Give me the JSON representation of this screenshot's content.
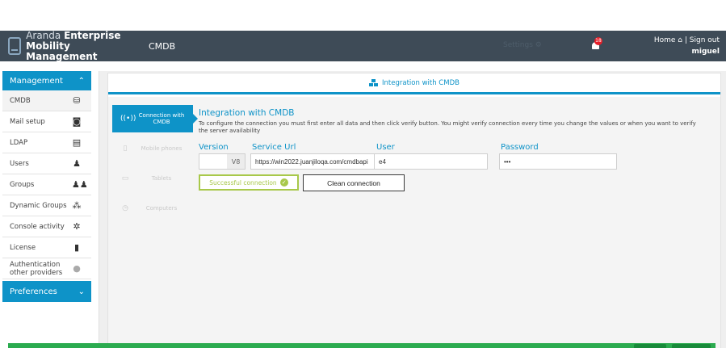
{
  "app": {
    "brand_line1_light": "Aranda ",
    "brand_line1_bold": "Enterprise",
    "brand_line2": "Mobility Management",
    "module": "CMDB",
    "settings_label": "Settings",
    "notifications_count": "18",
    "home_label": "Home",
    "signout_label": "Sign out",
    "username": "miguel"
  },
  "sidebar": {
    "section_title": "Management",
    "items": [
      {
        "label": "CMDB",
        "icon": "cmdb-icon",
        "glyph": "⛁"
      },
      {
        "label": "Mail setup",
        "icon": "mail-setup-icon",
        "glyph": "◙"
      },
      {
        "label": "LDAP",
        "icon": "ldap-icon",
        "glyph": "▤"
      },
      {
        "label": "Users",
        "icon": "user-icon",
        "glyph": "♟"
      },
      {
        "label": "Groups",
        "icon": "groups-icon",
        "glyph": "♟♟"
      },
      {
        "label": "Dynamic Groups",
        "icon": "dynamic-groups-icon",
        "glyph": "⁂"
      },
      {
        "label": "Console activity",
        "icon": "console-activity-icon",
        "glyph": "✲"
      },
      {
        "label": "License",
        "icon": "license-icon",
        "glyph": "▮"
      },
      {
        "label": "Authentication other providers",
        "icon": "auth-providers-icon",
        "glyph": "●"
      }
    ],
    "preferences_label": "Preferences"
  },
  "panel": {
    "title": "Integration with CMDB",
    "tabs": [
      {
        "label": "Connection with CMDB",
        "icon": "wireless-icon",
        "glyph": "((•))"
      },
      {
        "label": "Mobile phones",
        "icon": "mobile-phone-icon",
        "glyph": "▯"
      },
      {
        "label": "Tablets",
        "icon": "tablet-icon",
        "glyph": "▭"
      },
      {
        "label": "Computers",
        "icon": "computer-icon",
        "glyph": "◷"
      }
    ],
    "content": {
      "title": "Integration with CMDB",
      "description": "To configure the connection you must first enter all data and then click verify button. You might verify connection every time you change the values or when you want to verify the server availability",
      "version_label": "Version",
      "service_url_label": "Service Url",
      "user_label": "User",
      "password_label": "Password",
      "version_value": "V8",
      "service_url_value": "https://win2022.juanjiloqa.com/cmdbapi",
      "user_value": "e4",
      "password_value": "•••",
      "success_button": "Successful connection",
      "clean_button": "Clean connection"
    }
  },
  "colors": {
    "accent": "#0e93c8",
    "header_bg": "#3e4b57",
    "success": "#a8c84a",
    "footer": "#2bab4f"
  }
}
